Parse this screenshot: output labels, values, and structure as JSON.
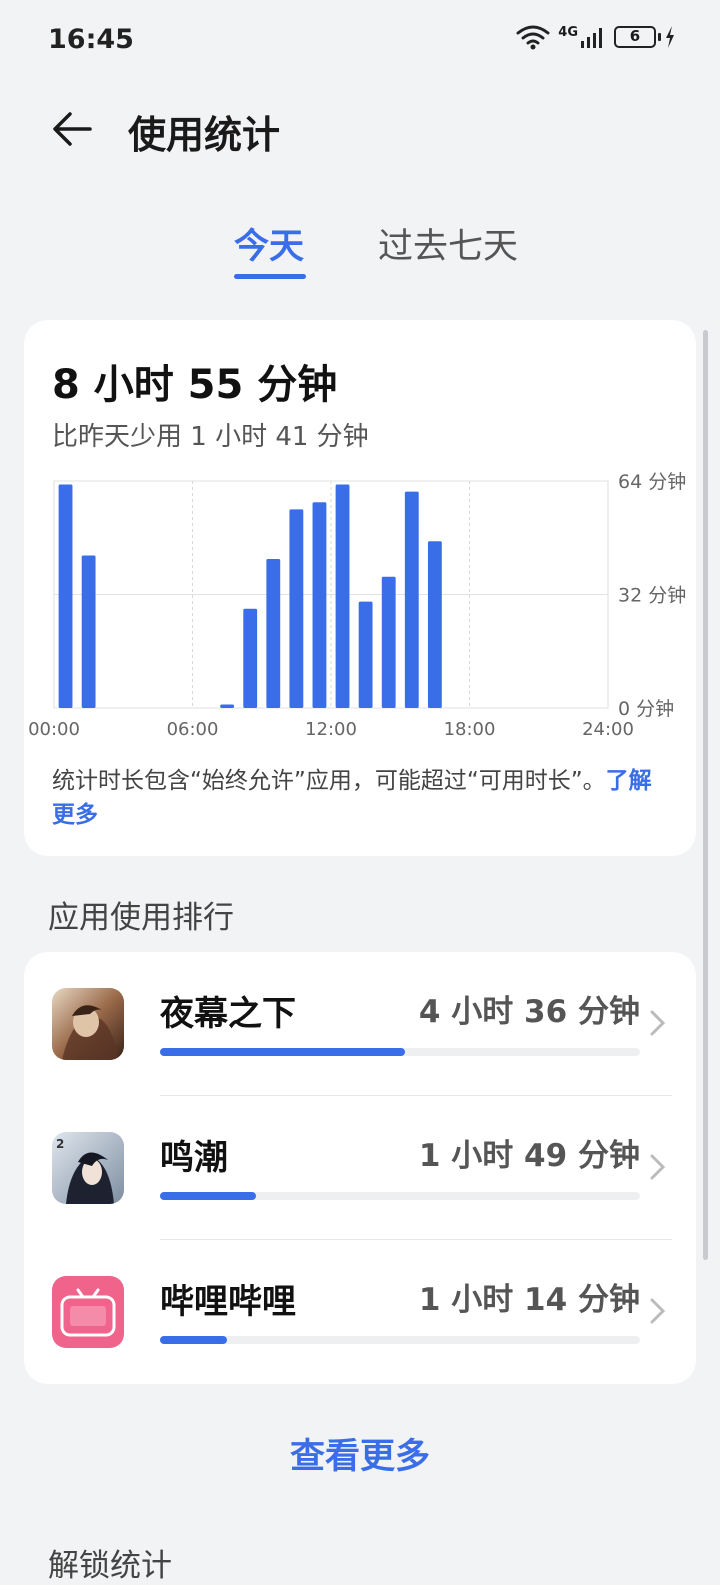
{
  "status_bar": {
    "time": "16:45",
    "network": "4G",
    "battery": "6"
  },
  "header": {
    "title": "使用统计"
  },
  "tabs": [
    {
      "label": "今天",
      "active": true
    },
    {
      "label": "过去七天",
      "active": false
    }
  ],
  "summary": {
    "total": "8 小时 55 分钟",
    "compare": "比昨天少用 1 小时 41 分钟",
    "note_text": "统计时长包含“始终允许”应用，可能超过“可用时长”。",
    "note_link": "了解更多"
  },
  "chart_data": {
    "type": "bar",
    "x_label_ticks": [
      "00:00",
      "06:00",
      "12:00",
      "18:00",
      "24:00"
    ],
    "y_label_ticks": [
      "0 分钟",
      "32 分钟",
      "64 分钟"
    ],
    "ylim": [
      0,
      64
    ],
    "xlim": [
      0,
      24
    ],
    "categories": [
      "0",
      "1",
      "2",
      "3",
      "4",
      "5",
      "6",
      "7",
      "8",
      "9",
      "10",
      "11",
      "12",
      "13",
      "14",
      "15",
      "16",
      "17",
      "18",
      "19",
      "20",
      "21",
      "22",
      "23"
    ],
    "values": [
      63,
      43,
      0,
      0,
      0,
      0,
      0,
      1,
      28,
      42,
      56,
      58,
      63,
      30,
      37,
      61,
      47,
      0,
      0,
      0,
      0,
      0,
      0,
      0
    ],
    "bar_color": "#3a6ee8",
    "grid": true
  },
  "ranking": {
    "title": "应用使用排行",
    "apps": [
      {
        "name": "夜幕之下",
        "time": "4 小时 36 分钟",
        "fraction": 0.51,
        "icon": "night-game-icon"
      },
      {
        "name": "鸣潮",
        "time": "1 小时 49 分钟",
        "fraction": 0.2,
        "icon": "wuthering-waves-icon"
      },
      {
        "name": "哔哩哔哩",
        "time": "1 小时 14 分钟",
        "fraction": 0.14,
        "icon": "bilibili-icon"
      }
    ],
    "view_more": "查看更多"
  },
  "unlock_section": {
    "title": "解锁统计"
  },
  "colors": {
    "accent": "#3a6ee8",
    "background": "#f1f3f5",
    "card": "#ffffff"
  }
}
